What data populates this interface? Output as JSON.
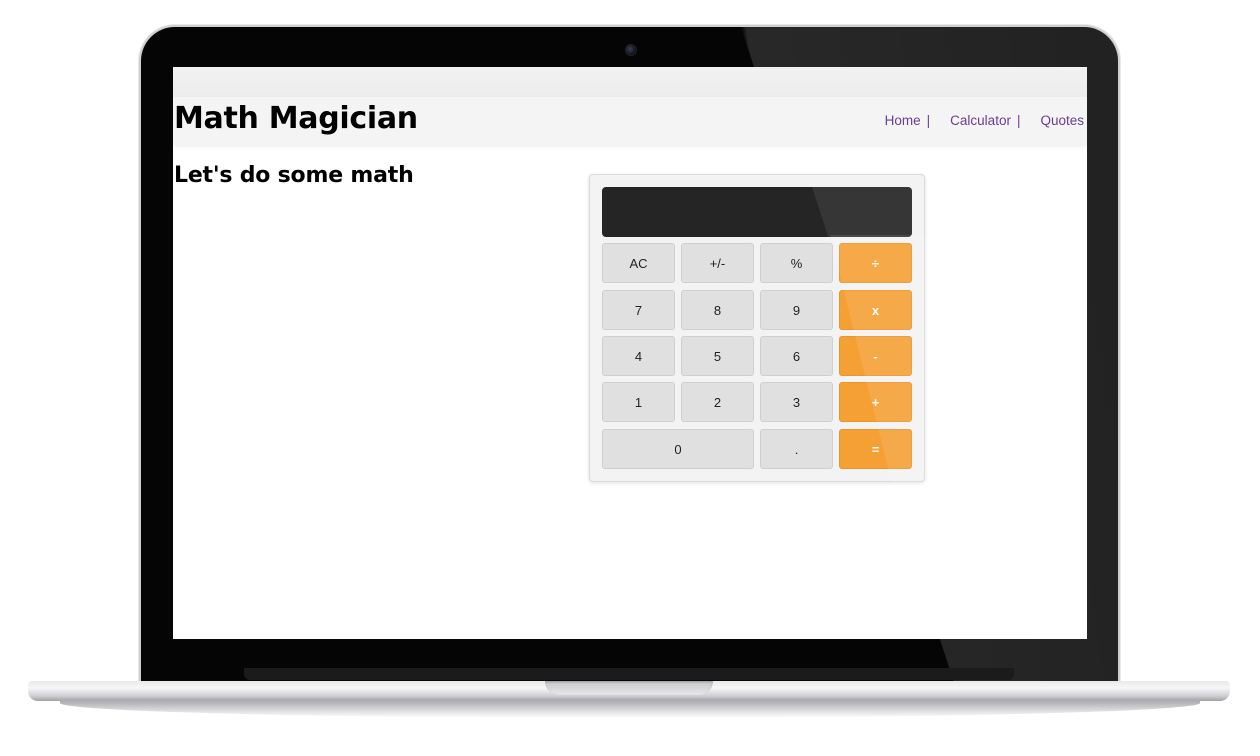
{
  "app": {
    "brand": "Math Magician",
    "subtitle": "Let's do some math"
  },
  "nav": {
    "items": [
      {
        "label": "Home"
      },
      {
        "label": "Calculator"
      },
      {
        "label": "Quotes"
      }
    ],
    "separator": "|"
  },
  "calculator": {
    "display": "",
    "keys": {
      "ac": "AC",
      "sign": "+/-",
      "percent": "%",
      "divide": "÷",
      "seven": "7",
      "eight": "8",
      "nine": "9",
      "multiply": "x",
      "four": "4",
      "five": "5",
      "six": "6",
      "minus": "-",
      "one": "1",
      "two": "2",
      "three": "3",
      "plus": "+",
      "zero": "0",
      "dot": ".",
      "equals": "="
    }
  },
  "colors": {
    "operator": "#f5a035",
    "key": "#e0e0e0",
    "display": "#252525",
    "nav_link": "#6a3d8f"
  }
}
